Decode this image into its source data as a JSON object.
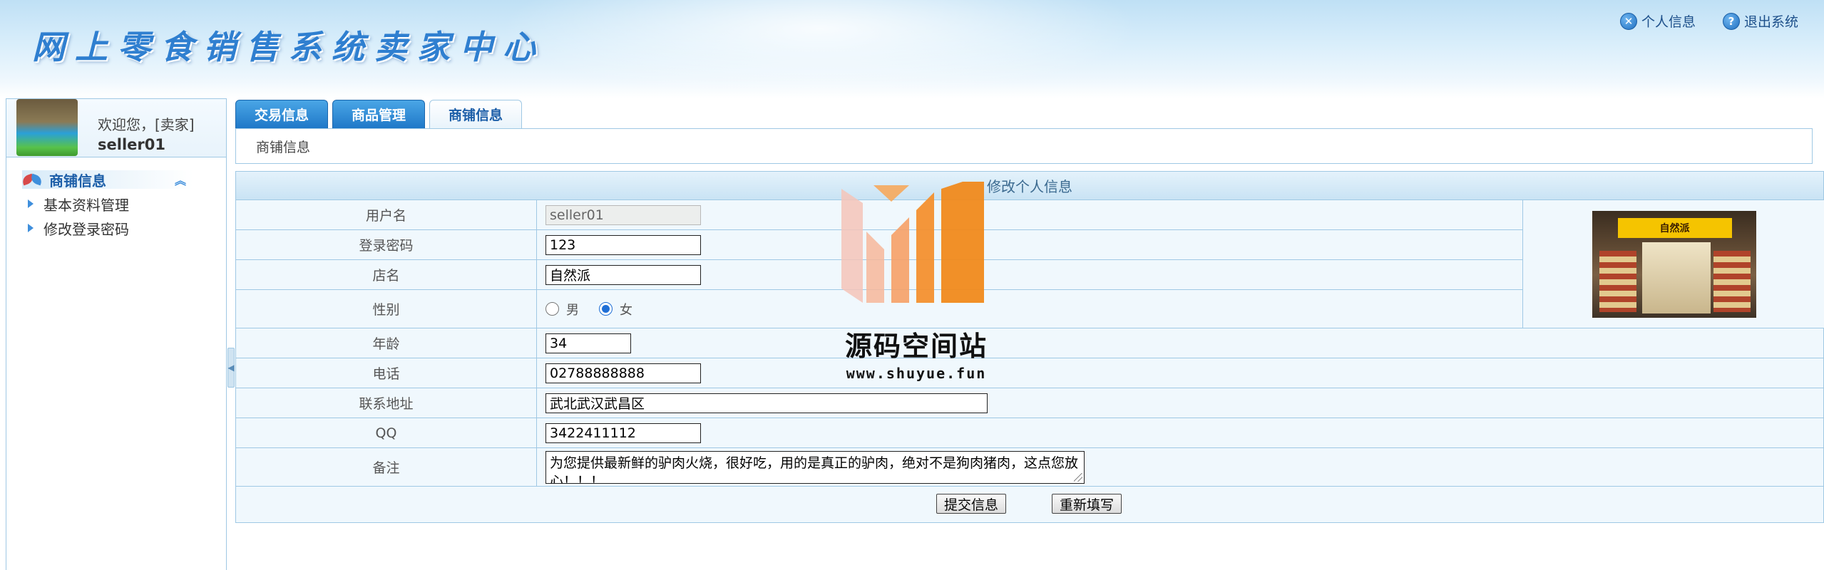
{
  "header": {
    "site_title": "网上零食销售系统卖家中心",
    "profile_link": "个人信息",
    "logout_link": "退出系统"
  },
  "sidebar": {
    "welcome": "欢迎您，[卖家]",
    "username": "seller01",
    "menu_head": "商铺信息",
    "items": [
      {
        "label": "基本资料管理"
      },
      {
        "label": "修改登录密码"
      }
    ]
  },
  "tabs": [
    {
      "label": "交易信息",
      "active": false
    },
    {
      "label": "商品管理",
      "active": false
    },
    {
      "label": "商铺信息",
      "active": true
    }
  ],
  "breadcrumb": "商铺信息",
  "form": {
    "title": "修改个人信息",
    "fields": {
      "username": {
        "label": "用户名",
        "value": "seller01"
      },
      "password": {
        "label": "登录密码",
        "value": "123"
      },
      "shop_name": {
        "label": "店名",
        "value": "自然派"
      },
      "gender": {
        "label": "性别",
        "options": [
          "男",
          "女"
        ],
        "selected": "女"
      },
      "age": {
        "label": "年龄",
        "value": "34"
      },
      "phone": {
        "label": "电话",
        "value": "02788888888"
      },
      "address": {
        "label": "联系地址",
        "value": "武北武汉武昌区"
      },
      "qq": {
        "label": "QQ",
        "value": "3422411112"
      },
      "remark": {
        "label": "备注",
        "value": "为您提供最新鲜的驴肉火烧，很好吃，用的是真正的驴肉，绝对不是狗肉猪肉，这点您放心！！！"
      }
    },
    "shop_sign": "自然派",
    "submit_label": "提交信息",
    "reset_label": "重新填写"
  },
  "watermark": {
    "text": "源码空间站",
    "url": "www.shuyue.fun"
  },
  "colors": {
    "accent": "#1f78c8",
    "border": "#9fc8e4",
    "form_bg": "#f0f8fd"
  }
}
